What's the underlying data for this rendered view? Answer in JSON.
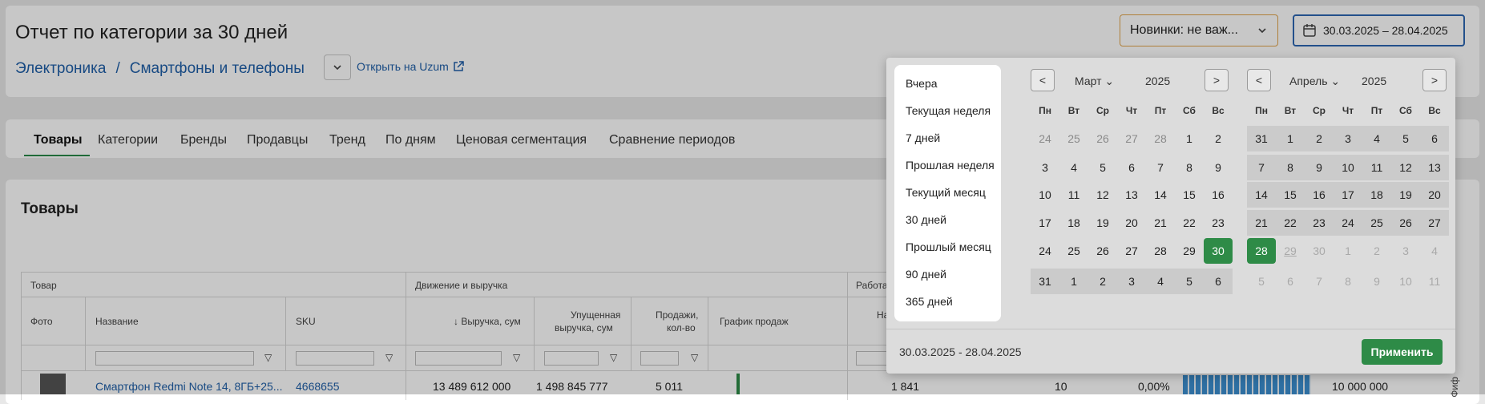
{
  "header": {
    "title": "Отчет по категории за 30 дней",
    "crumb_1": "Электроника",
    "crumb_sep": "/",
    "crumb_2": "Смартфоны и телефоны",
    "open_link": "Открыть на Uzum",
    "new_select": "Новинки: не важ...",
    "date_range": "30.03.2025 – 28.04.2025"
  },
  "tabs": [
    "Товары",
    "Категории",
    "Бренды",
    "Продавцы",
    "Тренд",
    "По дням",
    "Ценовая сегментация",
    "Сравнение периодов"
  ],
  "section_title": "Товары",
  "table": {
    "group_1": "Товар",
    "group_2": "Движение и выручка",
    "group_3": "Работа",
    "col_photo": "Фото",
    "col_name": "Название",
    "col_sku": "SKU",
    "col_revenue": "↓ Выручка, сум",
    "col_lost_1": "Упущенная",
    "col_lost_2": "выручка, сум",
    "col_sales_1": "Продажи,",
    "col_sales_2": "кол-во",
    "col_chart": "График продаж",
    "col_na": "На",
    "row": {
      "name": "Смартфон Redmi Note 14, 8ГБ+25...",
      "sku": "4668655",
      "revenue": "13 489 612 000",
      "lost": "1 498 845 777",
      "sales": "5 011",
      "v1": "1 841",
      "v2": "10",
      "v3": "0,00%",
      "v4": "10 000 000"
    }
  },
  "side_text": "Фиф",
  "datepicker": {
    "presets": [
      "Вчера",
      "Текущая неделя",
      "7 дней",
      "Прошлая неделя",
      "Текущий месяц",
      "30 дней",
      "Прошлый месяц",
      "90 дней",
      "365 дней"
    ],
    "left_month": "Март",
    "left_year": "2025",
    "right_month": "Апрель",
    "right_year": "2025",
    "prev": "<",
    "next": ">",
    "weekdays": [
      "Пн",
      "Вт",
      "Ср",
      "Чт",
      "Пт",
      "Сб",
      "Вс"
    ],
    "left_days": [
      "24",
      "25",
      "26",
      "27",
      "28",
      "1",
      "2",
      "3",
      "4",
      "5",
      "6",
      "7",
      "8",
      "9",
      "10",
      "11",
      "12",
      "13",
      "14",
      "15",
      "16",
      "17",
      "18",
      "19",
      "20",
      "21",
      "22",
      "23",
      "24",
      "25",
      "26",
      "27",
      "28",
      "29",
      "30",
      "31",
      "1",
      "2",
      "3",
      "4",
      "5",
      "6"
    ],
    "right_days": [
      "31",
      "1",
      "2",
      "3",
      "4",
      "5",
      "6",
      "7",
      "8",
      "9",
      "10",
      "11",
      "12",
      "13",
      "14",
      "15",
      "16",
      "17",
      "18",
      "19",
      "20",
      "21",
      "22",
      "23",
      "24",
      "25",
      "26",
      "27",
      "28",
      "29",
      "30",
      "1",
      "2",
      "3",
      "4",
      "5",
      "6",
      "7",
      "8",
      "9",
      "10",
      "11"
    ],
    "footer_range": "30.03.2025 - 28.04.2025",
    "apply": "Применить"
  }
}
